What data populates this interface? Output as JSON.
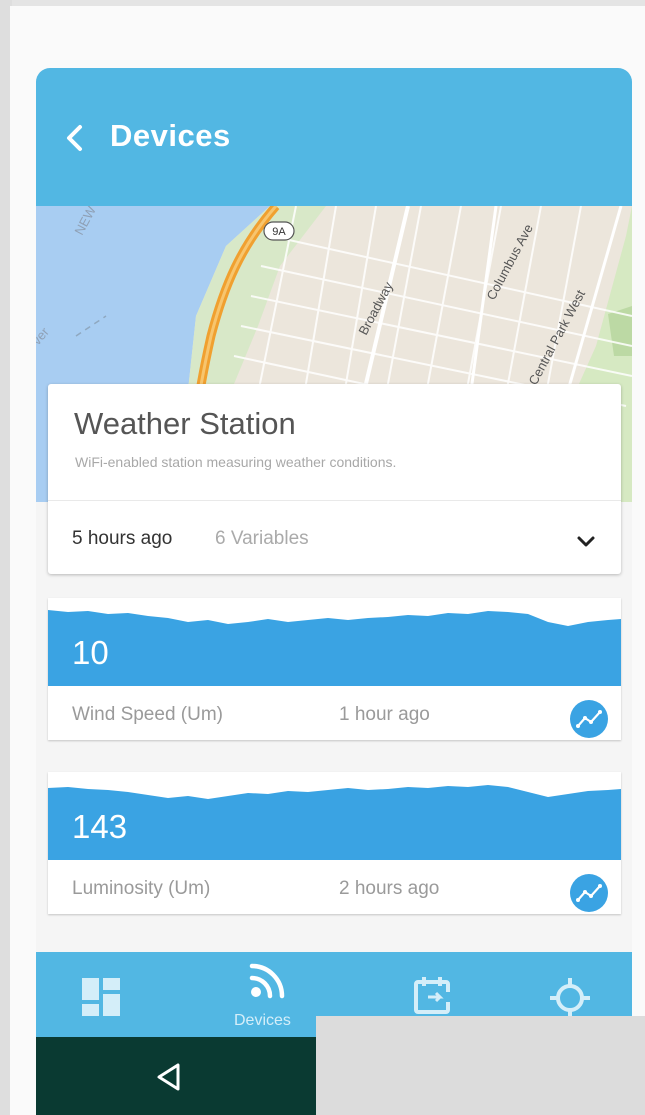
{
  "header": {
    "title": "Devices",
    "back_icon": "chevron-left-icon"
  },
  "map": {
    "labels": {
      "route": "9A",
      "street1": "Broadway",
      "street2": "Columbus Ave",
      "street3": "Central Park West",
      "partial1": "NEW",
      "partial2": "ver"
    },
    "colors": {
      "water": "#a8cdf2",
      "land": "#ece6dc",
      "park": "#cfe5b8",
      "road": "#f0a030"
    }
  },
  "device": {
    "name": "Weather Station",
    "description": "WiFi-enabled station measuring weather conditions.",
    "last_seen": "5 hours ago",
    "variables_count": "6 Variables",
    "expand_icon": "chevron-down-icon"
  },
  "variables": [
    {
      "value": "10",
      "name": "Wind Speed (Um)",
      "time": "1 hour ago",
      "icon": "line-chart-icon"
    },
    {
      "value": "143",
      "name": "Luminosity (Um)",
      "time": "2 hours ago",
      "icon": "line-chart-icon"
    }
  ],
  "bottom_nav": {
    "items": [
      {
        "icon": "dashboard-icon",
        "label": ""
      },
      {
        "icon": "devices-icon",
        "label": "Devices"
      },
      {
        "icon": "events-icon",
        "label": ""
      },
      {
        "icon": "location-icon",
        "label": ""
      }
    ]
  },
  "system_bar": {
    "back_icon": "triangle-back-icon"
  },
  "colors": {
    "accent": "#52b7e3",
    "chart_fill": "#3aa3e3",
    "text_dark": "#555555",
    "text_muted": "#a8a8a8"
  }
}
